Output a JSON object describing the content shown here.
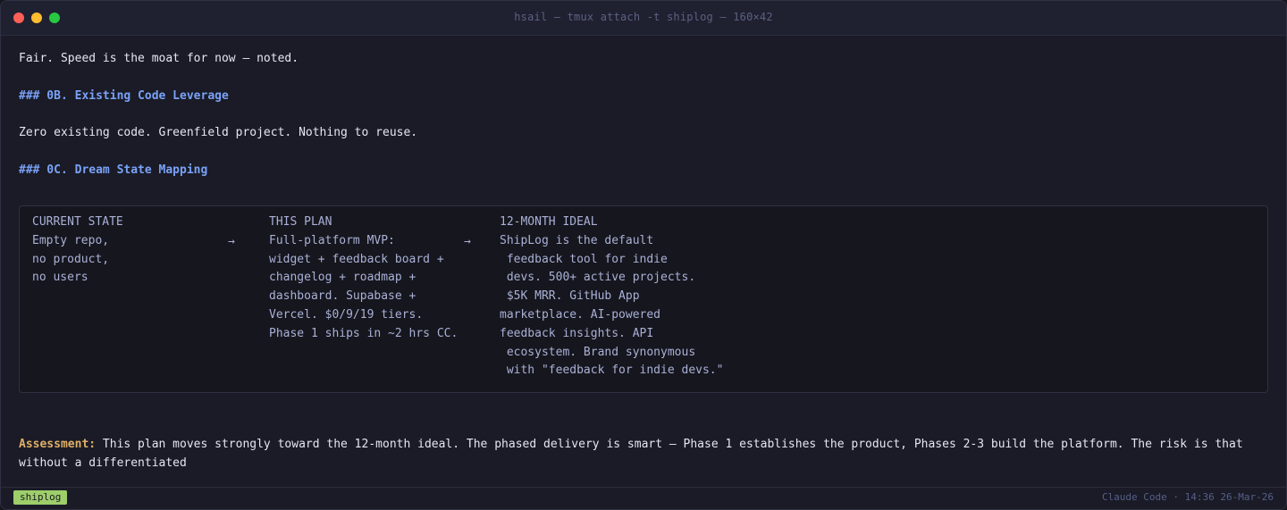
{
  "window": {
    "title": "hsail — tmux attach -t shiplog — 160×42"
  },
  "content": {
    "line1": "Fair. Speed is the moat for now — noted.",
    "heading_0b": "### 0B. Existing Code Leverage",
    "line_0b": "Zero existing code. Greenfield project. Nothing to reuse.",
    "heading_0c": "### 0C. Dream State Mapping",
    "mapping": {
      "current_state": {
        "header": "CURRENT STATE",
        "lines": [
          "Empty repo,",
          "no product,",
          "no users"
        ]
      },
      "this_plan": {
        "header": "THIS PLAN",
        "lines": [
          "Full-platform MVP:",
          "widget + feedback board +",
          "changelog + roadmap +",
          "dashboard. Supabase +",
          "Vercel. $0/9/19 tiers.",
          "Phase 1 ships in ~2 hrs CC."
        ]
      },
      "ideal": {
        "header": "12-MONTH IDEAL",
        "lines": [
          "ShipLog is the default",
          " feedback tool for indie",
          " devs. 500+ active projects.",
          " $5K MRR. GitHub App",
          "marketplace. AI-powered",
          "feedback insights. API",
          " ecosystem. Brand synonymous",
          " with \"feedback for indie devs.\""
        ]
      },
      "arrow": "→"
    },
    "assessment": {
      "label": "Assessment:",
      "text": " This plan moves strongly toward the 12-month ideal. The phased delivery is smart — Phase 1 establishes the product, Phases 2-3 build the platform. The risk is that without a differentiated"
    }
  },
  "statusbar": {
    "session": "shiplog",
    "right": "Claude Code · 14:36 26-Mar-26"
  },
  "colors": {
    "heading": "#7aa2f7",
    "assessment_label": "#e0af68",
    "session_badge": "#9ece6a"
  }
}
